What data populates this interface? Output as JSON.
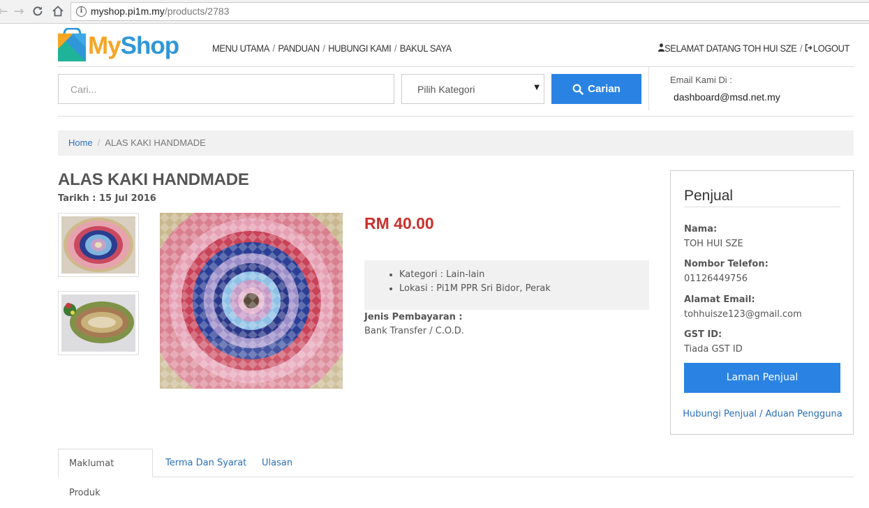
{
  "browser": {
    "url_domain": "myshop.pi1m.my",
    "url_path": "/products/2783"
  },
  "header": {
    "logo_my": "My",
    "logo_shop": "Shop",
    "nav": [
      "MENU UTAMA",
      "PANDUAN",
      "HUBUNGI KAMI",
      "BAKUL SAYA"
    ],
    "nav_separator": "/",
    "welcome": "SELAMAT DATANG TOH HUI SZE",
    "logout": "LOGOUT"
  },
  "search": {
    "placeholder": "Cari...",
    "category_selected": "Pilih Kategori",
    "button_label": "Carian"
  },
  "contact": {
    "label": "Email Kami Di :",
    "email": "dashboard@msd.net.my"
  },
  "breadcrumb": {
    "home": "Home",
    "current": "ALAS KAKI HANDMADE"
  },
  "product": {
    "title": "ALAS KAKI HANDMADE",
    "date": "Tarikh : 15 Jul 2016",
    "price": "RM 40.00",
    "details": [
      "Kategori : Lain-lain",
      "Lokasi : Pi1M PPR Sri Bidor, Perak"
    ],
    "payment_label": "Jenis Pembayaran :",
    "payment_value": "Bank Transfer / C.O.D."
  },
  "seller": {
    "title": "Penjual",
    "name_label": "Nama:",
    "name": "TOH HUI SZE",
    "phone_label": "Nombor Telefon:",
    "phone": "01126449756",
    "email_label": "Alamat Email:",
    "email": "tohhuisze123@gmail.com",
    "gst_label": "GST ID:",
    "gst": "Tiada GST ID",
    "button_label": "Laman Penjual",
    "contact_link": "Hubungi Penjual / Aduan Pengguna"
  },
  "tabs": [
    "Maklumat Produk",
    "Terma Dan Syarat",
    "Ulasan"
  ],
  "colors": {
    "accent_blue": "#2a83e3",
    "price_red": "#c9302c",
    "logo_orange": "#f6a623",
    "logo_blue": "#2f97d8"
  }
}
